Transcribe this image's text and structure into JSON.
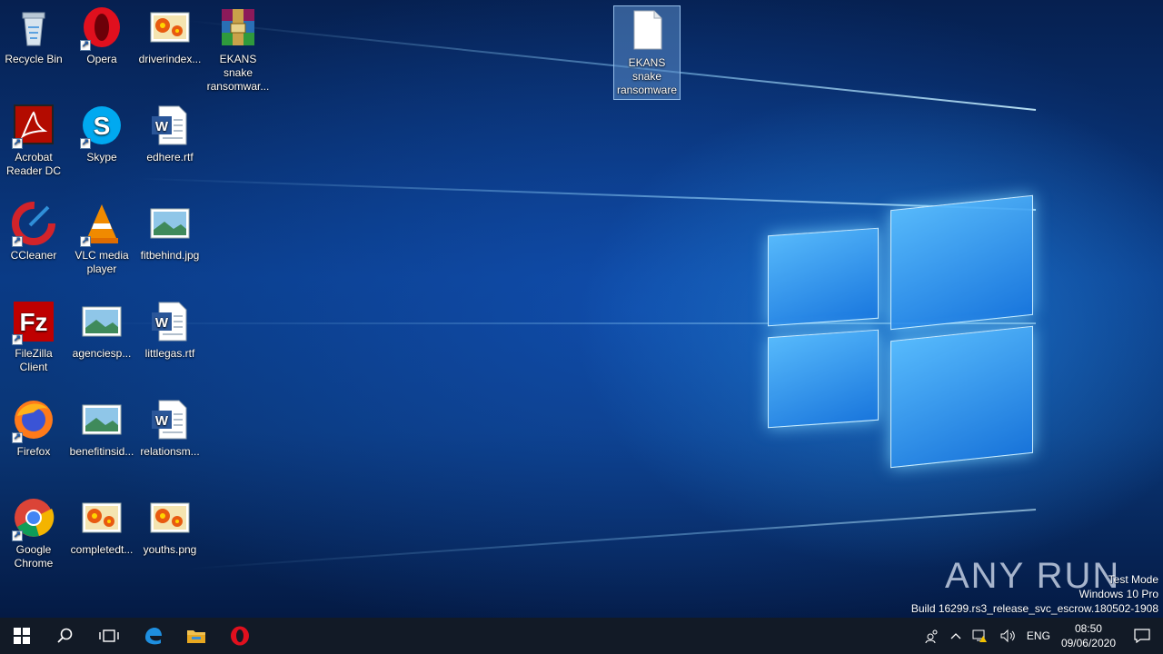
{
  "desktop": {
    "icons": [
      {
        "label": "Recycle Bin",
        "icon": "recycle-bin-icon"
      },
      {
        "label": "Opera",
        "icon": "opera-icon"
      },
      {
        "label": "driverindex...",
        "icon": "image-file-icon"
      },
      {
        "label": "EKANS snake ransomwar...",
        "icon": "winrar-icon"
      },
      {
        "label": "Acrobat Reader DC",
        "icon": "acrobat-icon"
      },
      {
        "label": "Skype",
        "icon": "skype-icon"
      },
      {
        "label": "edhere.rtf",
        "icon": "word-document-icon"
      },
      {
        "label": "CCleaner",
        "icon": "ccleaner-icon"
      },
      {
        "label": "VLC media player",
        "icon": "vlc-icon"
      },
      {
        "label": "fitbehind.jpg",
        "icon": "image-landscape-icon"
      },
      {
        "label": "FileZilla Client",
        "icon": "filezilla-icon"
      },
      {
        "label": "agenciesp...",
        "icon": "image-landscape-icon"
      },
      {
        "label": "littlegas.rtf",
        "icon": "word-document-icon"
      },
      {
        "label": "Firefox",
        "icon": "firefox-icon"
      },
      {
        "label": "benefitinsid...",
        "icon": "image-landscape-icon"
      },
      {
        "label": "relationsm...",
        "icon": "word-document-icon"
      },
      {
        "label": "Google Chrome",
        "icon": "chrome-icon"
      },
      {
        "label": "completedt...",
        "icon": "image-file-icon"
      },
      {
        "label": "youths.png",
        "icon": "image-file-icon"
      },
      {
        "label": "EKANS snake ransomware",
        "icon": "blank-file-icon"
      }
    ]
  },
  "watermark": {
    "brand": "ANY RUN",
    "line1": "Test Mode",
    "line2": "Windows 10 Pro",
    "line3": "Build 16299.rs3_release_svc_escrow.180502-1908"
  },
  "taskbar": {
    "pinned": [
      "start-icon",
      "search-icon",
      "task-view-icon",
      "edge-icon",
      "file-explorer-icon",
      "opera-icon"
    ],
    "tray": {
      "language": "ENG",
      "time": "08:50",
      "date": "09/06/2020"
    }
  },
  "colors": {
    "taskbar": "#121a26",
    "selection": "#5a8cc8"
  }
}
